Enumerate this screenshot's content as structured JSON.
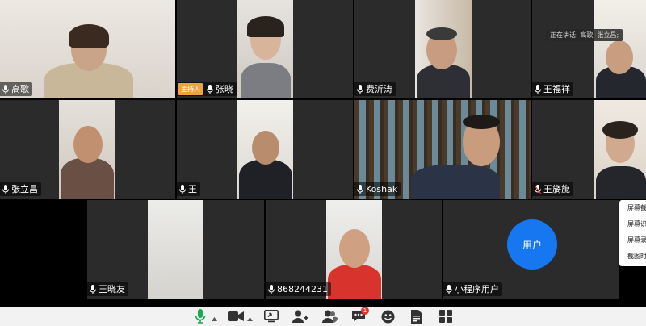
{
  "speaking_banner": "正在讲话: 高歌; 张立昌;",
  "host_badge": "主持人",
  "participants": [
    {
      "name": "高歌"
    },
    {
      "name": "张晓",
      "host": true
    },
    {
      "name": "费沂涛"
    },
    {
      "name": "王福祥"
    },
    {
      "name": "张立昌"
    },
    {
      "name": "王"
    },
    {
      "name": "Koshak"
    },
    {
      "name": "王旖旎"
    },
    {
      "name": "王晓友"
    },
    {
      "name": "868244231"
    },
    {
      "name": "小程序用户",
      "avatar_text": "用户"
    }
  ],
  "context_menu": {
    "items": [
      "屏幕截图",
      "屏幕识别",
      "屏幕录制",
      "截图时隐藏"
    ]
  },
  "toolbar": {
    "notification_count": "1",
    "accent_color": "#1aaa55",
    "icons": [
      "microphone-icon",
      "camera-icon",
      "share-screen-icon",
      "invite-icon",
      "participants-icon",
      "chat-icon",
      "reaction-icon",
      "document-icon",
      "apps-icon"
    ]
  }
}
